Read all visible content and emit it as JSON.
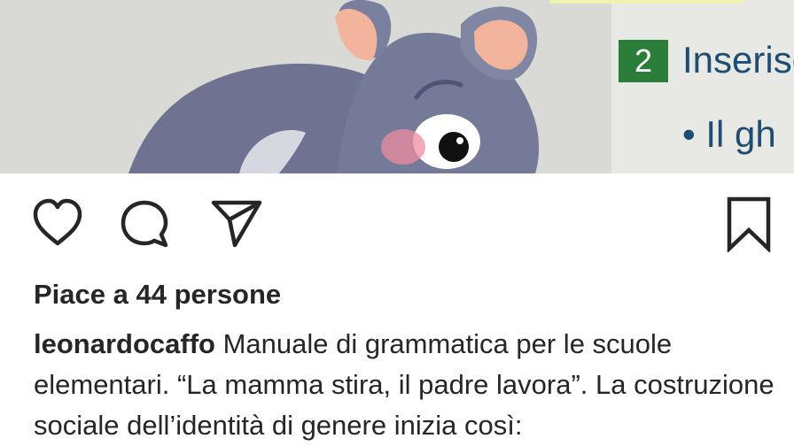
{
  "post": {
    "image": {
      "description_icon": "post-image",
      "book_number": "2",
      "book_word": "Inserisc",
      "book_bullet": "• Il gh"
    },
    "actions": {
      "like_icon": "heart-icon",
      "comment_icon": "comment-icon",
      "share_icon": "send-icon",
      "save_icon": "bookmark-icon"
    },
    "likes_text": "Piace a 44 persone",
    "username": "leonardocaffo",
    "caption_text": " Manuale di grammatica per le scuole elementari. “La mamma stira, il padre lavora”. La costruzione sociale dell’identità di genere inizia così:"
  },
  "colors": {
    "text": "#262626",
    "image_background": "#d9dad5",
    "book_green": "#2b7d3a",
    "book_blue": "#1e4d74",
    "elephant_gray": "#6f7391",
    "ear_pink": "#f3b49d"
  }
}
